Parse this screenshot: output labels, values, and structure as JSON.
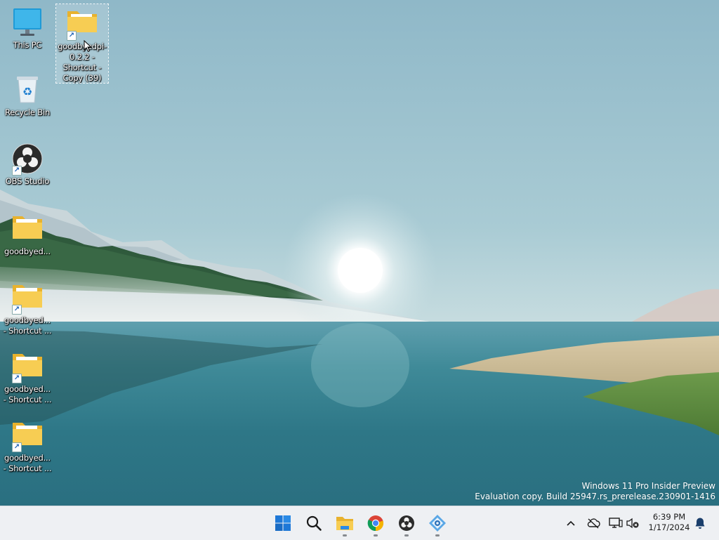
{
  "desktop": {
    "icons": [
      {
        "label": "This PC",
        "icon": "monitor-icon"
      },
      {
        "label": "goodbyedpi-\n0.2.2 -\nShortcut -\nCopy (39)",
        "icon": "folder-icon",
        "shortcut": true,
        "selected": true
      },
      {
        "label": "Recycle Bin",
        "icon": "recycle-bin-icon"
      },
      {
        "label": "OBS Studio",
        "icon": "obs-icon",
        "shortcut": true
      },
      {
        "label": "goodbyed...",
        "icon": "folder-icon"
      },
      {
        "label": "goodbyed...\n- Shortcut ...",
        "icon": "folder-icon",
        "shortcut": true
      },
      {
        "label": "goodbyed...\n- Shortcut ...",
        "icon": "folder-icon",
        "shortcut": true
      },
      {
        "label": "goodbyed...\n- Shortcut ...",
        "icon": "folder-icon",
        "shortcut": true
      }
    ]
  },
  "watermark": {
    "line1": "Windows 11 Pro Insider Preview",
    "line2": "Evaluation copy. Build 25947.rs_prerelease.230901-1416"
  },
  "taskbar": {
    "apps": [
      {
        "name": "Start",
        "icon": "windows-start-icon",
        "running": false
      },
      {
        "name": "Search",
        "icon": "search-icon",
        "running": false
      },
      {
        "name": "File Explorer",
        "icon": "file-explorer-icon",
        "running": true
      },
      {
        "name": "Google Chrome",
        "icon": "chrome-icon",
        "running": true
      },
      {
        "name": "OBS Studio",
        "icon": "obs-icon",
        "running": true
      },
      {
        "name": "App",
        "icon": "settings-app-icon",
        "running": true
      }
    ],
    "tray": {
      "icons": [
        "chevron-up-icon",
        "cloud-offline-icon",
        "network-icon",
        "volume-muted-icon",
        "notification-bell-icon"
      ],
      "time": "6:39 PM",
      "date": "1/17/2024"
    }
  },
  "colors": {
    "taskbar_bg": "#eef0f3",
    "folder_yellow": "#f4c542",
    "start_blue": "#1e78d7"
  }
}
